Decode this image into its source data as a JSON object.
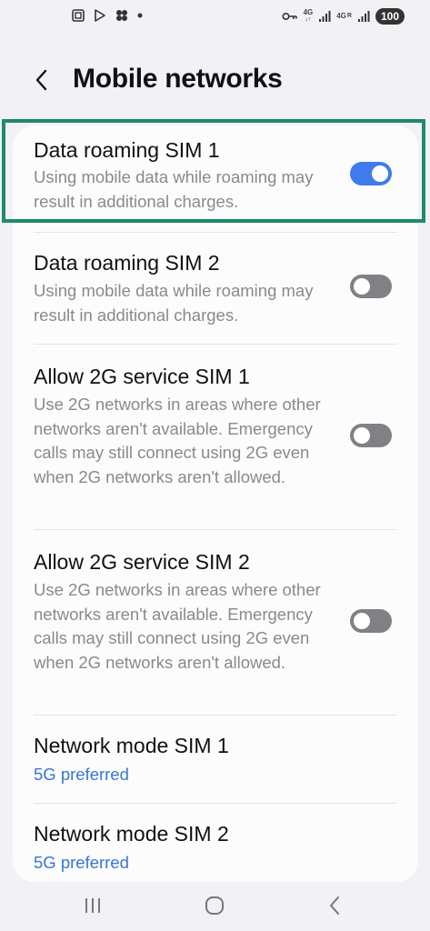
{
  "status_bar": {
    "net1": "4G",
    "net2": "4G",
    "net2_sub": "R",
    "battery": "100"
  },
  "header": {
    "title": "Mobile networks"
  },
  "settings": [
    {
      "title": "Data roaming SIM 1",
      "description": "Using mobile data while roaming may result in additional charges.",
      "toggle": true
    },
    {
      "title": "Data roaming SIM 2",
      "description": "Using mobile data while roaming may result in additional charges.",
      "toggle": false
    },
    {
      "title": "Allow 2G service SIM 1",
      "description": "Use 2G networks in areas where other networks aren't available. Emergency calls may still connect using 2G even when 2G networks aren't allowed.",
      "toggle": false
    },
    {
      "title": "Allow 2G service SIM 2",
      "description": "Use 2G networks in areas where other networks aren't available. Emergency calls may still connect using 2G even when 2G networks aren't allowed.",
      "toggle": false
    },
    {
      "title": "Network mode SIM 1",
      "value": "5G preferred"
    },
    {
      "title": "Network mode SIM 2",
      "value": "5G preferred"
    }
  ],
  "colors": {
    "accent": "#3e7bec",
    "link": "#3a76d0",
    "highlight": "#1e8a6e"
  }
}
